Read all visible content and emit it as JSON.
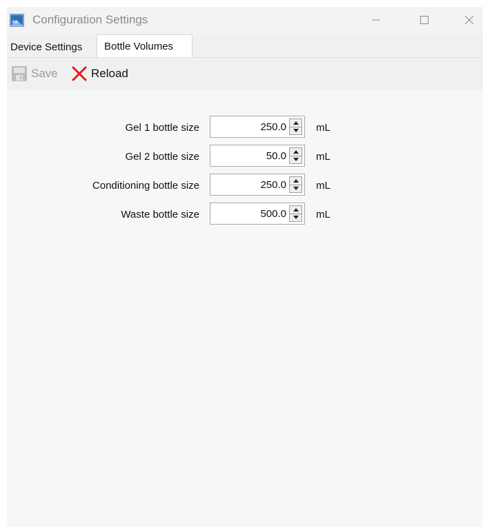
{
  "window": {
    "title": "Configuration Settings",
    "icon": "app-logo-icon",
    "controls": [
      "minimize-icon",
      "maximize-icon",
      "close-icon"
    ]
  },
  "tabs": [
    {
      "label": "Device Settings",
      "active": false
    },
    {
      "label": "Bottle Volumes",
      "active": true
    }
  ],
  "toolbar": {
    "save_label": "Save",
    "save_enabled": false,
    "reload_label": "Reload"
  },
  "bottles": [
    {
      "label": "Gel 1 bottle size",
      "value": "250.0",
      "unit": "mL"
    },
    {
      "label": "Gel 2 bottle size",
      "value": "50.0",
      "unit": "mL"
    },
    {
      "label": "Conditioning bottle size",
      "value": "250.0",
      "unit": "mL"
    },
    {
      "label": "Waste bottle size",
      "value": "500.0",
      "unit": "mL"
    }
  ],
  "colors": {
    "reload_icon": "#e21b1b",
    "disabled_text": "#9a9a9a",
    "background": "#f7f7f7"
  }
}
